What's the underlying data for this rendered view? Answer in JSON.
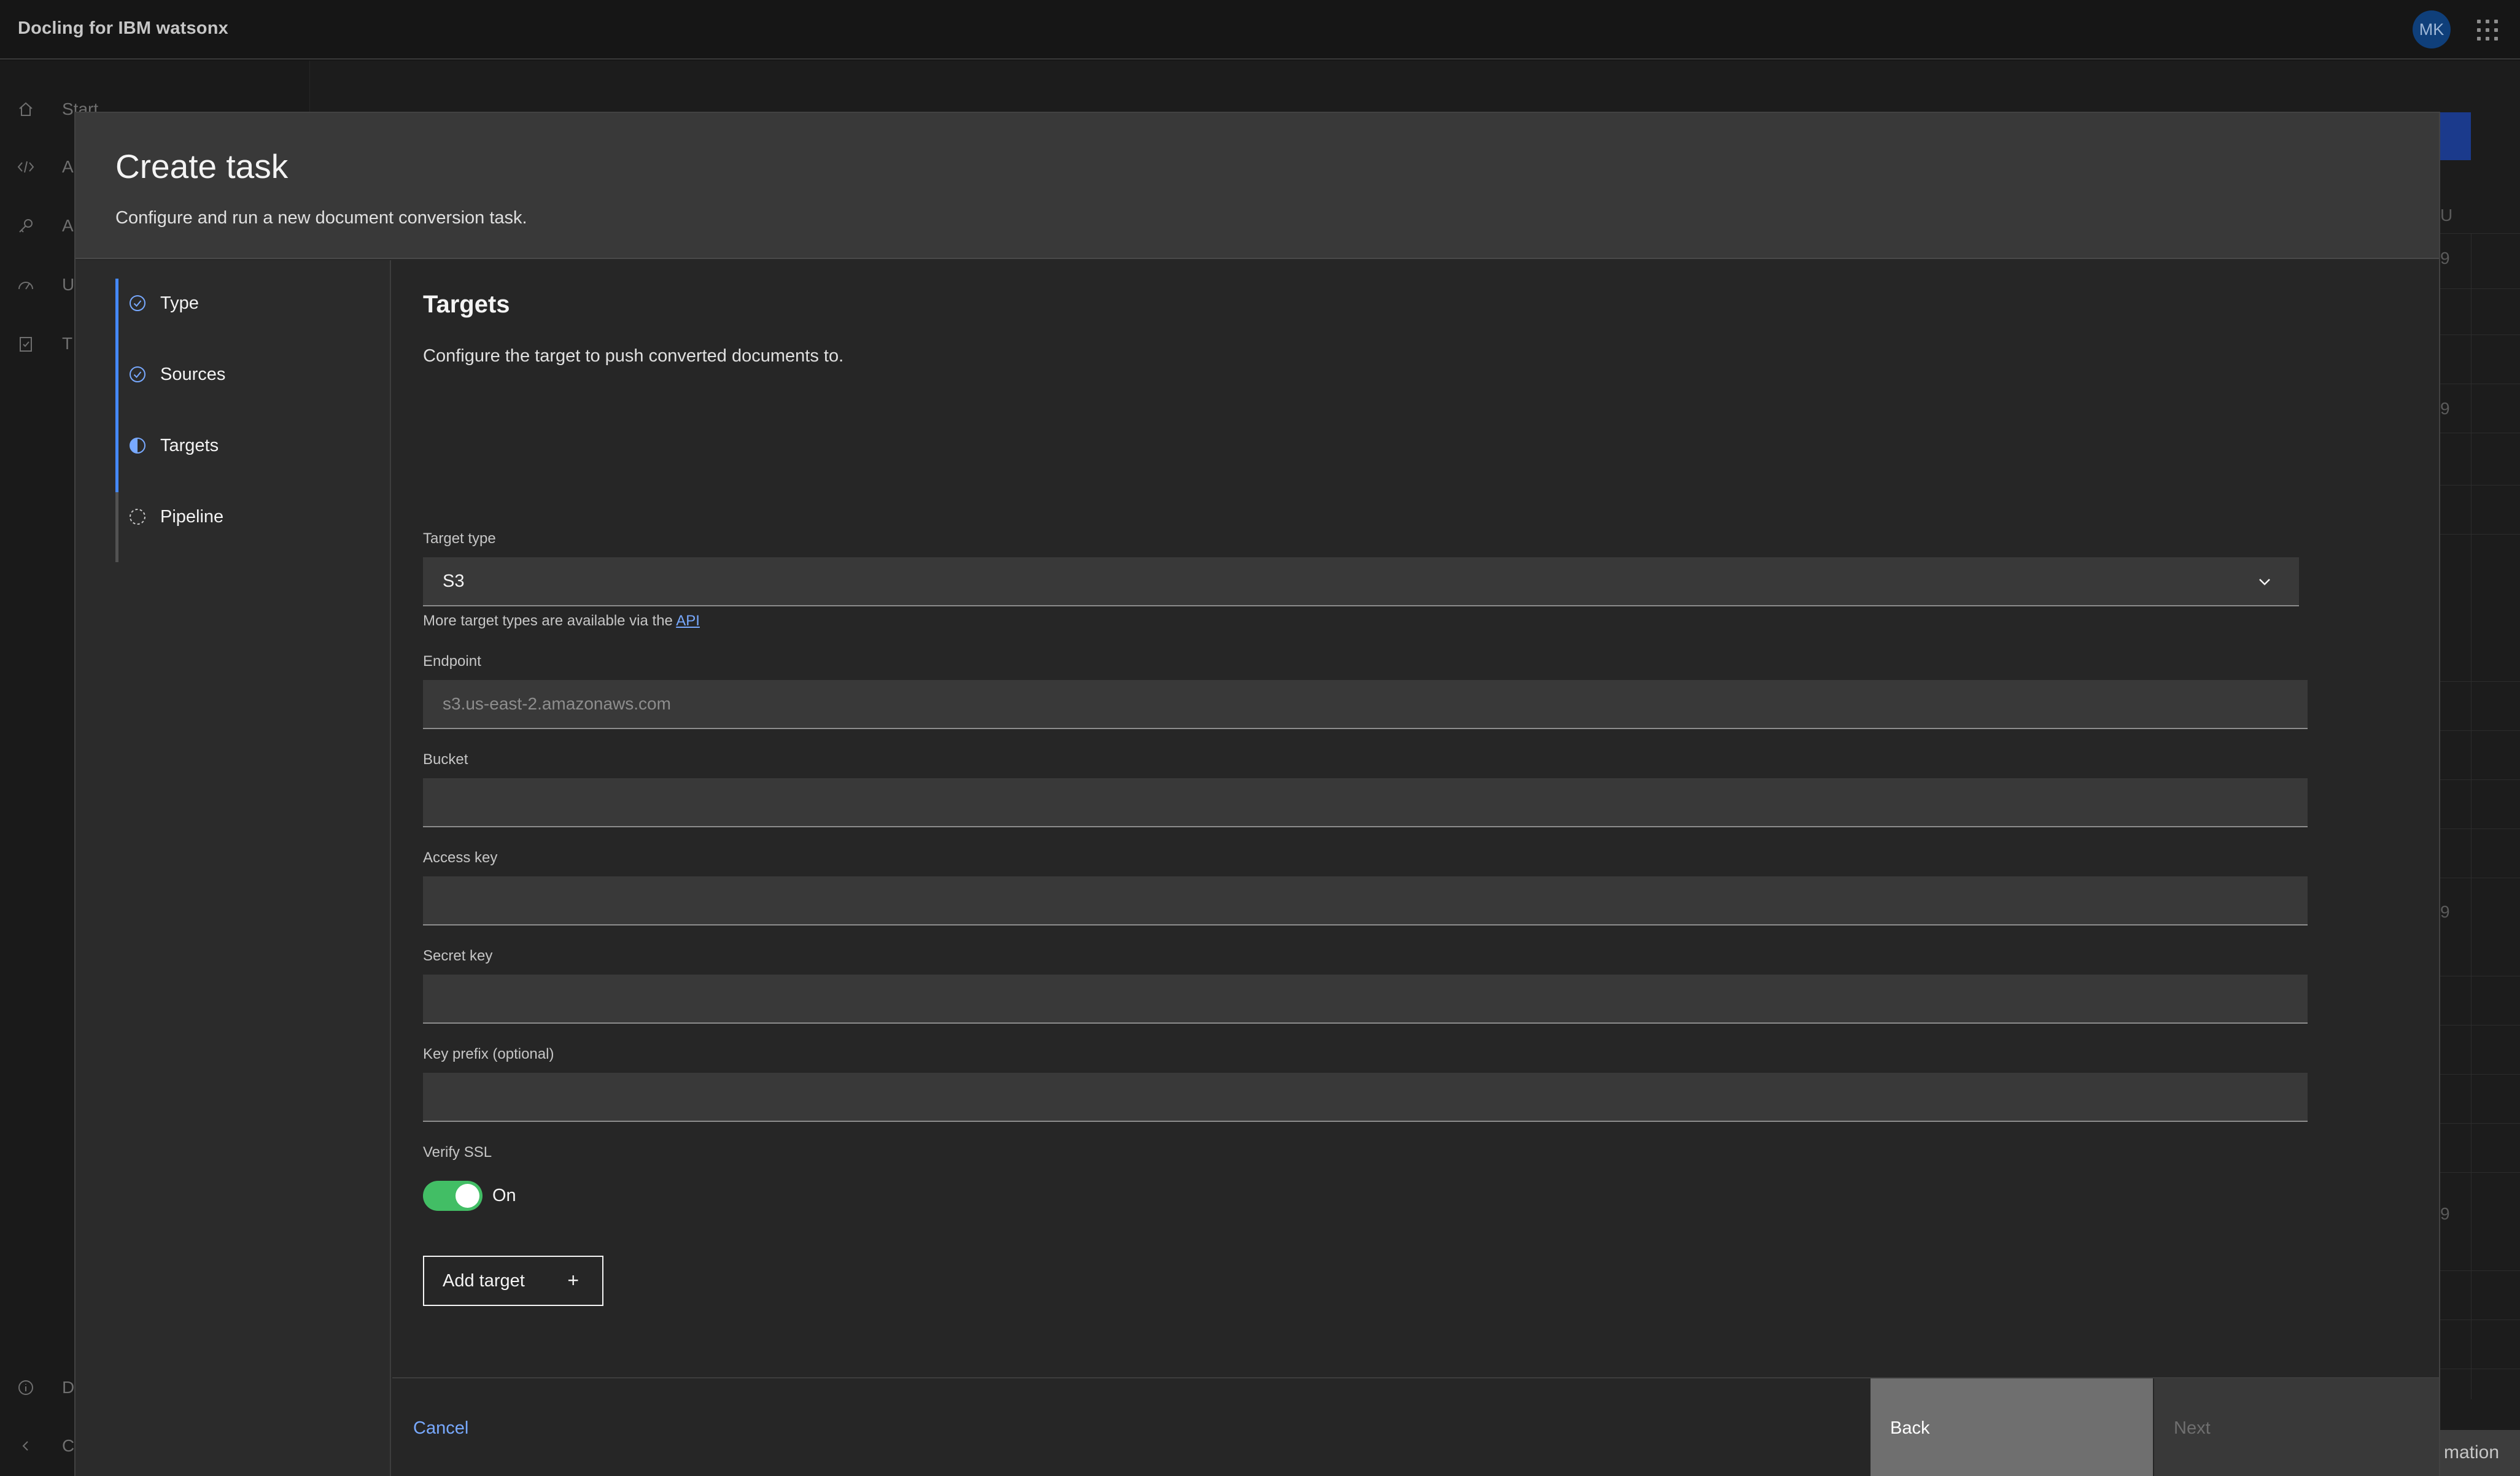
{
  "app": {
    "title": "Docling for IBM watsonx",
    "avatar_initials": "MK"
  },
  "sidenav": {
    "items": [
      {
        "label": "Start",
        "icon": "home-icon"
      },
      {
        "label": "A",
        "icon": "code-icon"
      },
      {
        "label": "A",
        "icon": "key-icon"
      },
      {
        "label": "U",
        "icon": "gauge-icon"
      },
      {
        "label": "T",
        "icon": "clipboard-icon"
      },
      {
        "label": "D",
        "icon": "info-icon"
      },
      {
        "label": "C",
        "icon": "chevron-left-icon"
      }
    ]
  },
  "background": {
    "fragments": [
      "U",
      "9",
      "9",
      "9",
      "9"
    ],
    "bottom_tab": "mation"
  },
  "modal": {
    "title": "Create task",
    "subtitle": "Configure and run a new document conversion task."
  },
  "steps": [
    {
      "label": "Type",
      "state": "complete"
    },
    {
      "label": "Sources",
      "state": "complete"
    },
    {
      "label": "Targets",
      "state": "current"
    },
    {
      "label": "Pipeline",
      "state": "incomplete"
    }
  ],
  "targets": {
    "title": "Targets",
    "description": "Configure the target to push converted documents to.",
    "target_type_label": "Target type",
    "target_type_value": "S3",
    "helper_text": "More target types are available via the",
    "helper_link": "API",
    "endpoint_label": "Endpoint",
    "endpoint_placeholder": "s3.us-east-2.amazonaws.com",
    "bucket_label": "Bucket",
    "access_key_label": "Access key",
    "secret_key_label": "Secret key",
    "key_prefix_label": "Key prefix (optional)",
    "verify_ssl_label": "Verify SSL",
    "verify_ssl_state": "On",
    "add_target_label": "Add target"
  },
  "footer": {
    "cancel": "Cancel",
    "back": "Back",
    "next": "Next"
  },
  "colors": {
    "accent": "#4589ff",
    "link": "#78a9ff",
    "toggle_on": "#42be65",
    "modal_bg": "#262626",
    "header_bg": "#393939"
  }
}
